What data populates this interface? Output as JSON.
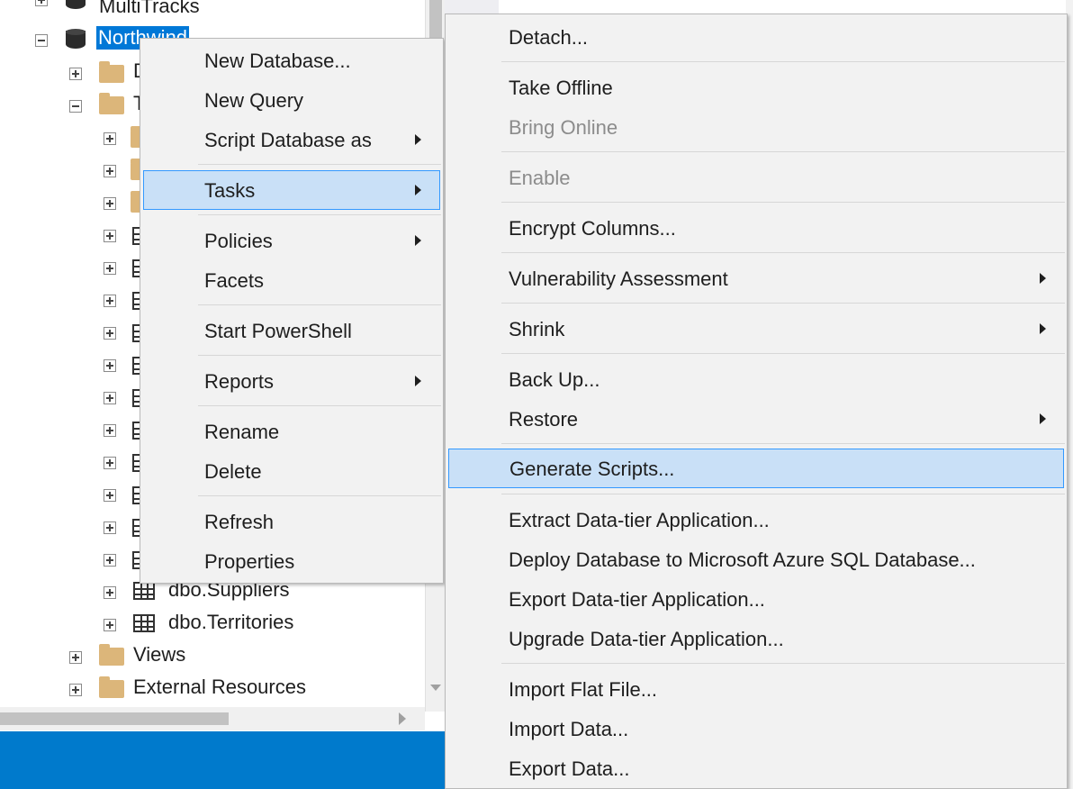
{
  "tree": {
    "items": [
      {
        "label": "MultiTracks",
        "expander": "plus",
        "icon": "database-icon"
      },
      {
        "label": "Northwind",
        "expander": "minus",
        "icon": "database-icon",
        "selected": true
      },
      {
        "label": "D",
        "expander": "plus",
        "icon": "folder-icon"
      },
      {
        "label": "T",
        "expander": "minus",
        "icon": "folder-icon"
      },
      {
        "label": "dbo.Suppliers",
        "expander": "plus",
        "icon": "table-icon"
      },
      {
        "label": "dbo.Territories",
        "expander": "plus",
        "icon": "table-icon"
      },
      {
        "label": "Views",
        "expander": "plus",
        "icon": "folder-icon"
      },
      {
        "label": "External Resources",
        "expander": "plus",
        "icon": "folder-icon"
      }
    ]
  },
  "context_menu": {
    "items": [
      {
        "label": "New Database..."
      },
      {
        "label": "New Query"
      },
      {
        "label": "Script Database as",
        "submenu": true
      },
      {
        "label": "Tasks",
        "submenu": true,
        "highlighted": true
      },
      {
        "label": "Policies",
        "submenu": true
      },
      {
        "label": "Facets"
      },
      {
        "label": "Start PowerShell"
      },
      {
        "label": "Reports",
        "submenu": true
      },
      {
        "label": "Rename"
      },
      {
        "label": "Delete"
      },
      {
        "label": "Refresh"
      },
      {
        "label": "Properties"
      }
    ]
  },
  "tasks_menu": {
    "items": [
      {
        "label": "Detach..."
      },
      {
        "label": "Take Offline"
      },
      {
        "label": "Bring Online",
        "disabled": true
      },
      {
        "label": "Enable",
        "disabled": true
      },
      {
        "label": "Encrypt Columns..."
      },
      {
        "label": "Vulnerability Assessment",
        "submenu": true
      },
      {
        "label": "Shrink",
        "submenu": true
      },
      {
        "label": "Back Up..."
      },
      {
        "label": "Restore",
        "submenu": true
      },
      {
        "label": "Generate Scripts...",
        "highlighted": true
      },
      {
        "label": "Extract Data-tier Application..."
      },
      {
        "label": "Deploy Database to Microsoft Azure SQL Database..."
      },
      {
        "label": "Export Data-tier Application..."
      },
      {
        "label": "Upgrade Data-tier Application..."
      },
      {
        "label": "Import Flat File..."
      },
      {
        "label": "Import Data..."
      },
      {
        "label": "Export Data..."
      }
    ]
  },
  "colors": {
    "accent": "#0078d7",
    "highlight_bg": "#c9e0f7",
    "highlight_border": "#3399ff",
    "status_bar": "#007acc",
    "menu_bg": "#f2f2f2",
    "disabled_text": "#8c8c8c",
    "folder": "#dcb67a"
  }
}
